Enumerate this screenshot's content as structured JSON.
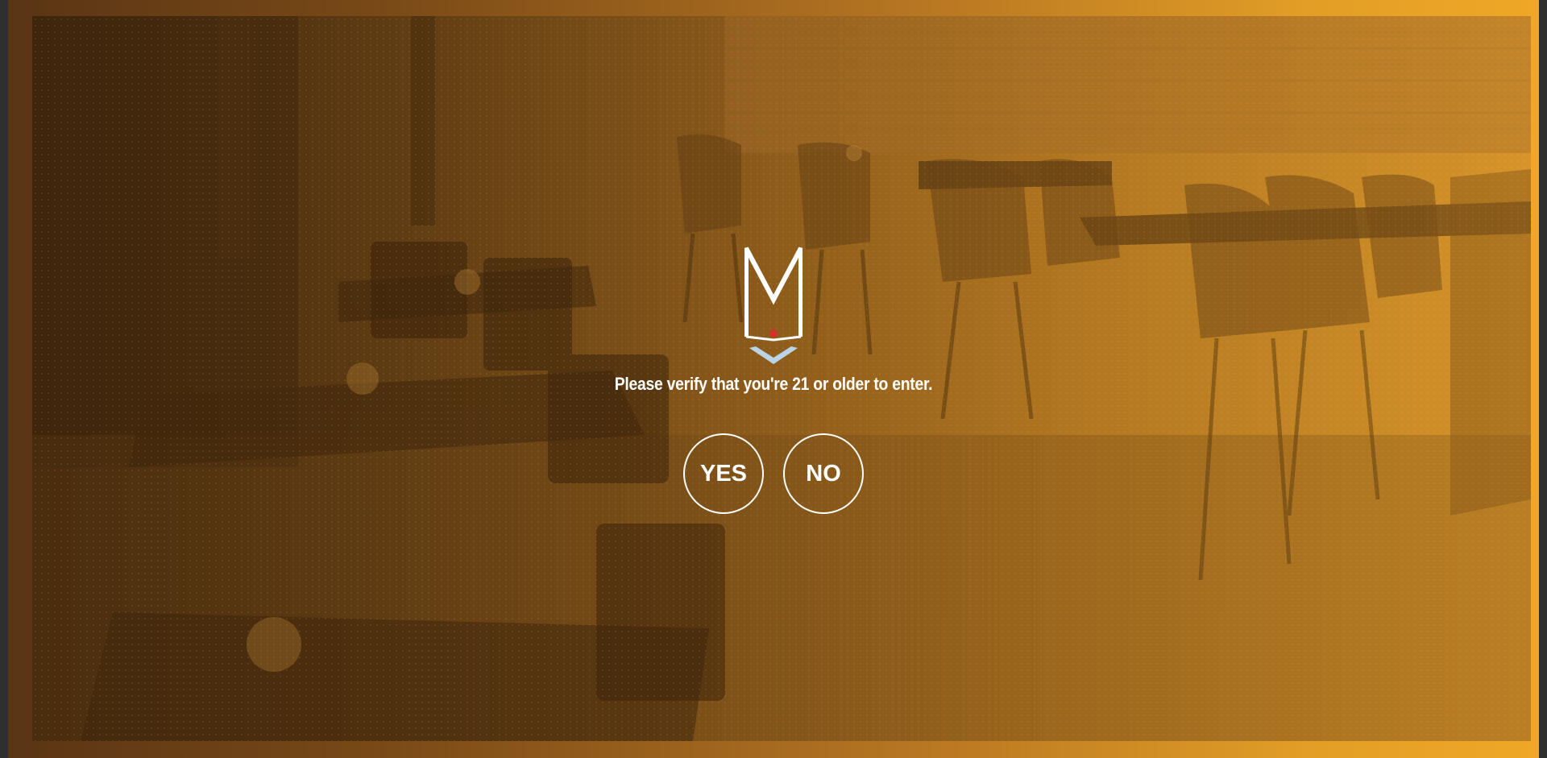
{
  "age_gate": {
    "logo_icon": "m-monogram-logo",
    "prompt": "Please verify that you're 21 or older to enter.",
    "yes_label": "YES",
    "no_label": "NO"
  },
  "colors": {
    "frame_gradient_start": "#5a3514",
    "frame_gradient_end": "#f0a726",
    "logo_red_dot": "#d4302a",
    "logo_chevron": "#b8d4e6",
    "text": "#ffffff"
  }
}
